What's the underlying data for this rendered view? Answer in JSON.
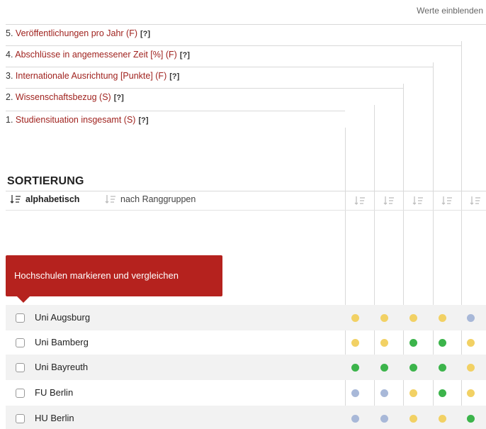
{
  "header": {
    "toggle_values": "Werte einblenden"
  },
  "criteria": [
    {
      "num": "5.",
      "label": "Veröffentlichungen pro Jahr (F)",
      "help": "[?]"
    },
    {
      "num": "4.",
      "label": "Abschlüsse in angemessener Zeit [%] (F)",
      "help": "[?]"
    },
    {
      "num": "3.",
      "label": "Internationale Ausrichtung [Punkte] (F)",
      "help": "[?]"
    },
    {
      "num": "2.",
      "label": "Wissenschaftsbezug (S)",
      "help": "[?]"
    },
    {
      "num": "1.",
      "label": "Studiensituation insgesamt (S)",
      "help": "[?]"
    }
  ],
  "sorting": {
    "title": "SORTIERUNG",
    "alphabetical": "alphabetisch",
    "by_rank": "nach Ranggruppen",
    "column_sort_icon": "sort-icon"
  },
  "tooltip": {
    "text": "Hochschulen markieren und vergleichen"
  },
  "colors": {
    "yellow": "#f2d164",
    "green": "#3cb44b",
    "blue": "#a8b8d8",
    "accent": "#b5221e"
  },
  "universities": [
    {
      "name": "Uni Augsburg",
      "ratings": [
        "yellow",
        "yellow",
        "yellow",
        "yellow",
        "blue"
      ]
    },
    {
      "name": "Uni Bamberg",
      "ratings": [
        "yellow",
        "yellow",
        "green",
        "green",
        "yellow"
      ]
    },
    {
      "name": "Uni Bayreuth",
      "ratings": [
        "green",
        "green",
        "green",
        "green",
        "yellow"
      ]
    },
    {
      "name": "FU Berlin",
      "ratings": [
        "blue",
        "blue",
        "yellow",
        "green",
        "yellow"
      ]
    },
    {
      "name": "HU Berlin",
      "ratings": [
        "blue",
        "blue",
        "yellow",
        "yellow",
        "green"
      ]
    }
  ]
}
